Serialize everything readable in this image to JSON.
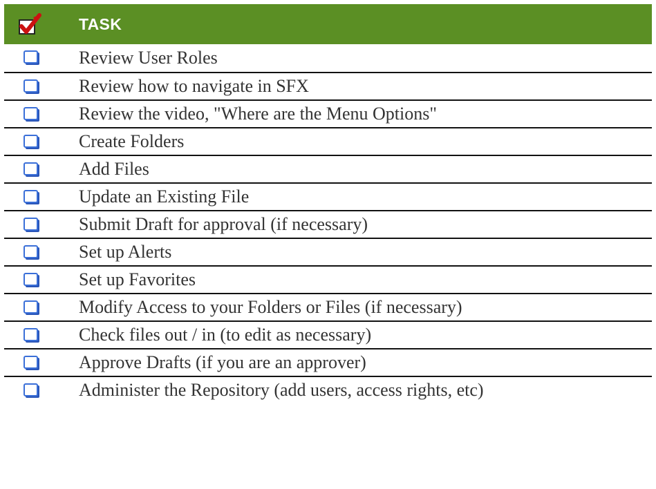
{
  "header": {
    "icon": "checked-box-icon",
    "label": "TASK"
  },
  "tasks": [
    {
      "label": "Review User Roles",
      "icon": "unchecked-checkbox-icon"
    },
    {
      "label": "Review how to navigate in SFX",
      "icon": "unchecked-checkbox-icon"
    },
    {
      "label": "Review the video, \"Where are the Menu Options\"",
      "icon": "unchecked-checkbox-icon"
    },
    {
      "label": "Create Folders",
      "icon": "unchecked-checkbox-icon"
    },
    {
      "label": "Add Files",
      "icon": "unchecked-checkbox-icon"
    },
    {
      "label": "Update an Existing File",
      "icon": "unchecked-checkbox-icon"
    },
    {
      "label": "Submit Draft for approval (if necessary)",
      "icon": "unchecked-checkbox-icon"
    },
    {
      "label": "Set up Alerts",
      "icon": "unchecked-checkbox-icon"
    },
    {
      "label": "Set up Favorites",
      "icon": "unchecked-checkbox-icon"
    },
    {
      "label": "Modify Access to your Folders or Files (if necessary)",
      "icon": "unchecked-checkbox-icon"
    },
    {
      "label": "Check files out / in (to edit as necessary)",
      "icon": "unchecked-checkbox-icon"
    },
    {
      "label": "Approve Drafts (if you are an approver)",
      "icon": "unchecked-checkbox-icon"
    },
    {
      "label": "Administer the Repository (add users, access rights, etc)",
      "icon": "unchecked-checkbox-icon"
    }
  ],
  "colors": {
    "header_bg": "#5b8f24",
    "header_text": "#ffffff",
    "checkbox_blue": "#3a6fd8",
    "check_red": "#cc1111",
    "row_text": "#333333"
  }
}
